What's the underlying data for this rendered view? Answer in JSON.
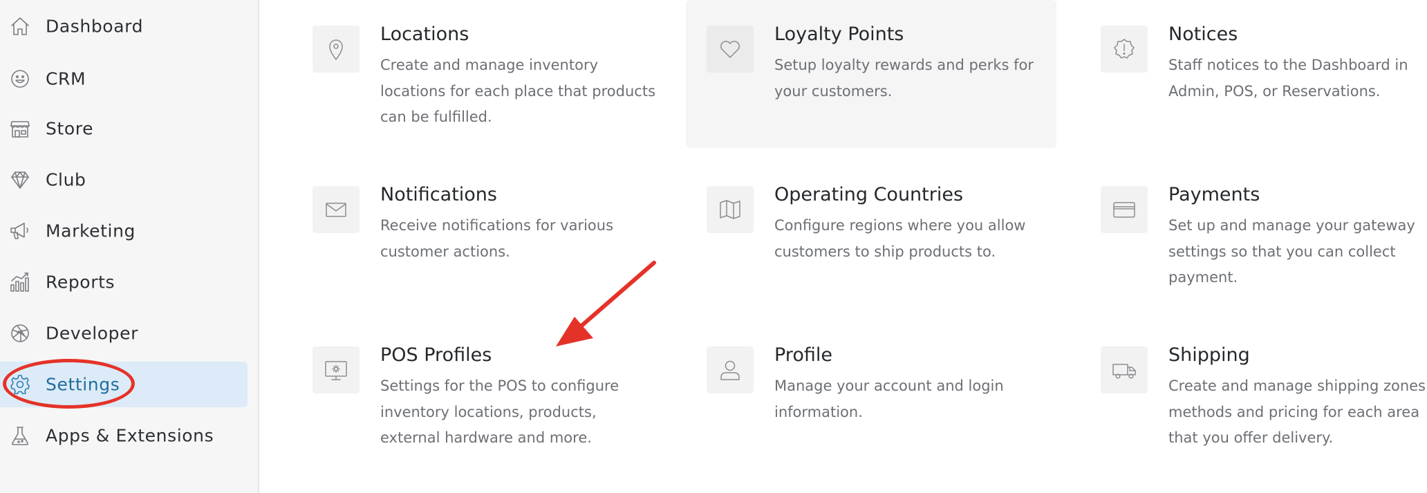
{
  "sidebar": {
    "items": [
      {
        "label": "Dashboard",
        "icon": "home-icon"
      },
      {
        "label": "CRM",
        "icon": "smiley-icon"
      },
      {
        "label": "Store",
        "icon": "storefront-icon"
      },
      {
        "label": "Club",
        "icon": "diamond-icon"
      },
      {
        "label": "Marketing",
        "icon": "megaphone-icon"
      },
      {
        "label": "Reports",
        "icon": "bar-chart-icon"
      },
      {
        "label": "Developer",
        "icon": "aperture-icon"
      },
      {
        "label": "Settings",
        "icon": "gear-icon",
        "active": true
      },
      {
        "label": "Apps & Extensions",
        "icon": "flask-icon"
      }
    ]
  },
  "cards": [
    {
      "title": "Locations",
      "description": "Create and manage inventory locations for each place that products can be fulfilled.",
      "icon": "map-pin-icon"
    },
    {
      "title": "Loyalty Points",
      "description": "Setup loyalty rewards and perks for your customers.",
      "icon": "heart-icon"
    },
    {
      "title": "Notices",
      "description": "Staff notices to the Dashboard in Admin, POS, or Reservations.",
      "icon": "alert-badge-icon"
    },
    {
      "title": "Notifications",
      "description": "Receive notifications for various customer actions.",
      "icon": "envelope-icon"
    },
    {
      "title": "Operating Countries",
      "description": "Configure regions where you allow customers to ship products to.",
      "icon": "map-icon"
    },
    {
      "title": "Payments",
      "description": "Set up and manage your gateway settings so that you can collect payment.",
      "icon": "credit-card-icon"
    },
    {
      "title": "POS Profiles",
      "description": "Settings for the POS to configure inventory locations, products, external hardware and more.",
      "icon": "monitor-gear-icon"
    },
    {
      "title": "Profile",
      "description": "Manage your account and login information.",
      "icon": "user-icon"
    },
    {
      "title": "Shipping",
      "description": "Create and manage shipping zones, methods and pricing for each area that you offer delivery.",
      "icon": "truck-icon"
    }
  ],
  "colors": {
    "annotation_red": "#e53228",
    "active_bg": "#dcebf7",
    "active_text": "#1f6e9e"
  }
}
